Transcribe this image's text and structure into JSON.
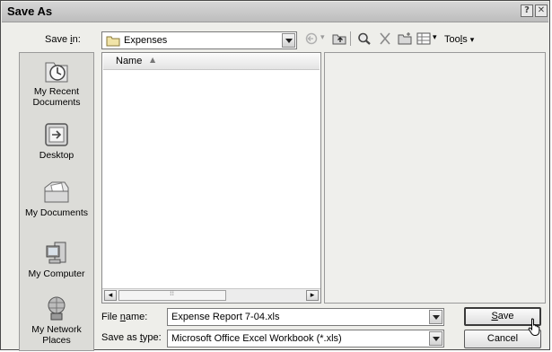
{
  "dialog": {
    "title": "Save As",
    "help_btn": "?",
    "close_btn": "✕"
  },
  "save_in": {
    "label_pre": "Save ",
    "label_ul": "i",
    "label_post": "n:",
    "value": "Expenses"
  },
  "toolbar": {
    "tools_pre": "Too",
    "tools_ul": "l",
    "tools_post": "s"
  },
  "places": [
    {
      "label": "My Recent Documents",
      "icon": "recent-documents-icon"
    },
    {
      "label": "Desktop",
      "icon": "desktop-icon"
    },
    {
      "label": "My Documents",
      "icon": "my-documents-icon"
    },
    {
      "label": "My Computer",
      "icon": "my-computer-icon"
    },
    {
      "label": "My Network Places",
      "icon": "network-places-icon"
    }
  ],
  "filelist": {
    "column_name": "Name"
  },
  "filename": {
    "label_pre": "File ",
    "label_ul": "n",
    "label_post": "ame:",
    "value": "Expense Report 7-04.xls"
  },
  "filetype": {
    "label_pre": "Save as ",
    "label_ul": "t",
    "label_post": "ype:",
    "value": "Microsoft Office Excel Workbook (*.xls)"
  },
  "buttons": {
    "save_ul": "S",
    "save_post": "ave",
    "cancel": "Cancel"
  }
}
